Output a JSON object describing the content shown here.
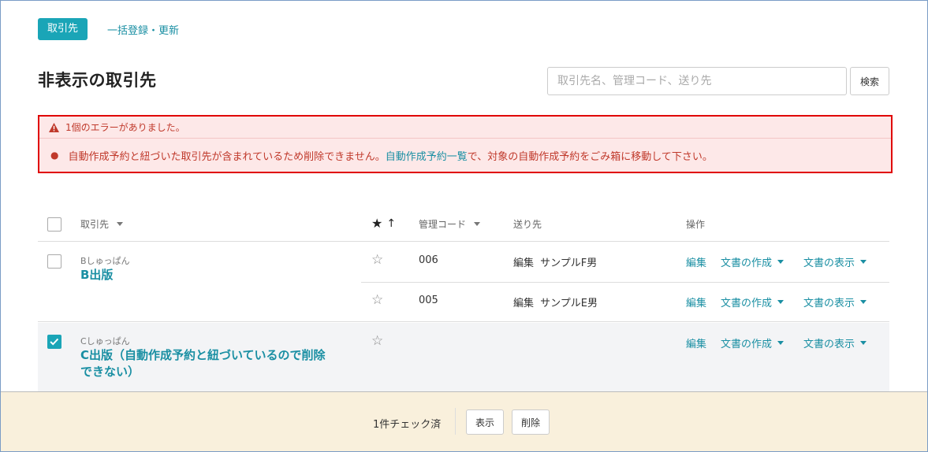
{
  "tabs": {
    "active_label": "取引先",
    "bulk_link": "一括登録・更新"
  },
  "page": {
    "title": "非表示の取引先"
  },
  "search": {
    "placeholder": "取引先名、管理コード、送り先",
    "button_label": "検索"
  },
  "error": {
    "header": "1個のエラーがありました。",
    "message_before": "自動作成予約と紐づいた取引先が含まれているため削除できません。",
    "message_link": "自動作成予約一覧",
    "message_after": "で、対象の自動作成予約をごみ箱に移動して下さい。"
  },
  "table": {
    "columns": {
      "name": "取引先",
      "star_sort": "↑",
      "code": "管理コード",
      "destination": "送り先",
      "actions": "操作"
    },
    "action_labels": {
      "edit": "編集",
      "create_doc": "文書の作成",
      "view_doc": "文書の表示"
    },
    "rows": [
      {
        "kana": "Bしゅっぱん",
        "name": "B出版",
        "checked": false,
        "subrows": [
          {
            "code": "006",
            "dest_edit": "編集",
            "dest_name": "サンプルF男"
          },
          {
            "code": "005",
            "dest_edit": "編集",
            "dest_name": "サンプルE男"
          }
        ]
      },
      {
        "kana": "Cしゅっぱん",
        "name_line1": "C出版（自動作成予約と紐づいているので削除",
        "name_line2": "できない）",
        "checked": true
      }
    ]
  },
  "footer": {
    "checked_count": "1件チェック済",
    "show_button": "表示",
    "delete_button": "削除"
  },
  "colors": {
    "accent": "#1aa5b7",
    "link": "#1a8fa3",
    "error_text": "#c0392b",
    "error_border": "#e00000",
    "error_bg": "#fde8e8",
    "footer_bg": "#f9f0dc",
    "selected_row_bg": "#f3f4f6"
  }
}
